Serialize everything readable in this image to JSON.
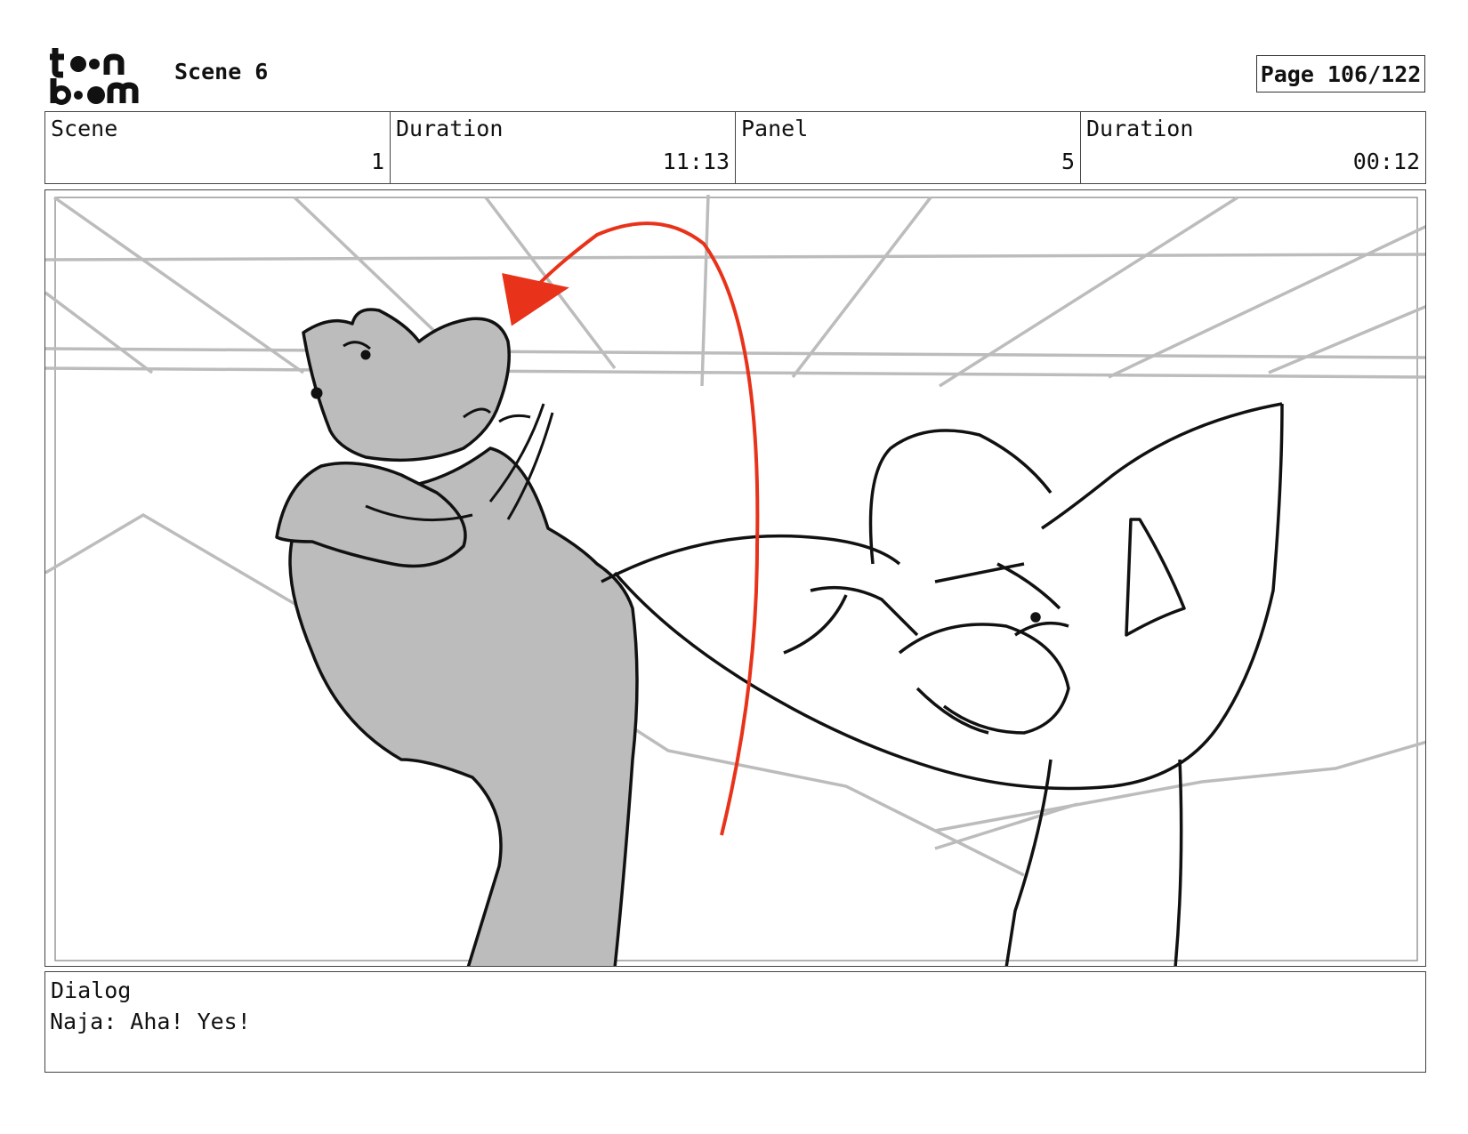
{
  "header": {
    "logo_text": "toon boom",
    "scene_title": "Scene 6",
    "page": "Page 106/122"
  },
  "info": {
    "scene_label": "Scene",
    "scene_value": "1",
    "scene_duration_label": "Duration",
    "scene_duration_value": "11:13",
    "panel_label": "Panel",
    "panel_value": "5",
    "panel_duration_label": "Duration",
    "panel_duration_value": "00:12"
  },
  "panel": {
    "arrow_color": "#e8321a",
    "sketch_gray": "#bcbcbc"
  },
  "dialog": {
    "label": "Dialog",
    "text": "Naja: Aha! Yes!"
  }
}
